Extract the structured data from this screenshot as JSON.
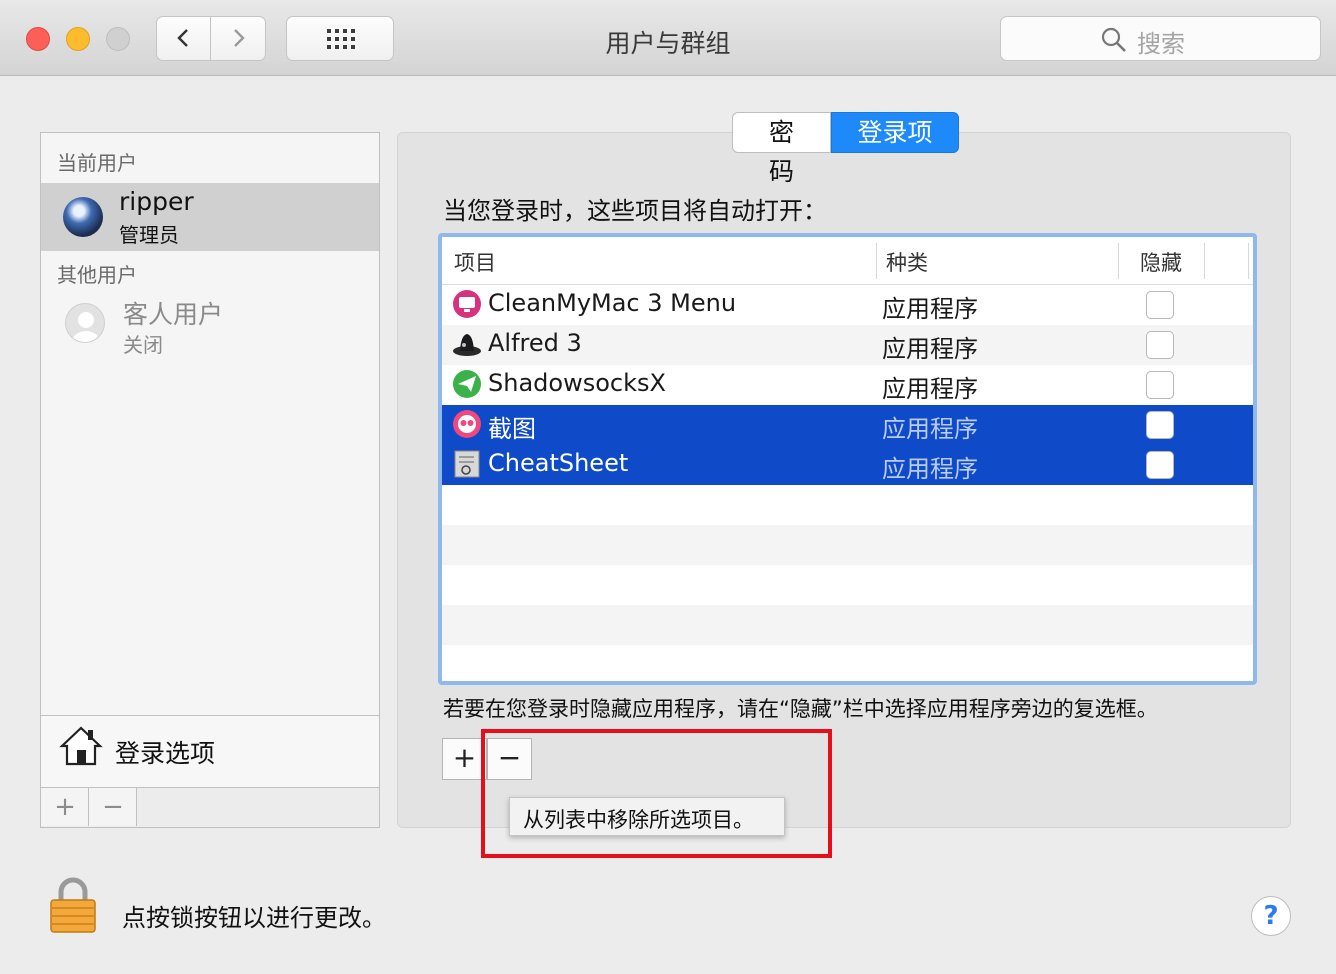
{
  "window": {
    "title": "用户与群组"
  },
  "toolbar": {
    "search_placeholder": "搜索"
  },
  "users": {
    "current_label": "当前用户",
    "current": {
      "name": "ripper",
      "role": "管理员"
    },
    "other_label": "其他用户",
    "guest": {
      "name": "客人用户",
      "state": "关闭"
    },
    "login_options": "登录选项",
    "add_glyph": "+",
    "remove_glyph": "−"
  },
  "tabs": [
    {
      "label": "密码"
    },
    {
      "label": "登录项"
    }
  ],
  "login_items": {
    "intro": "当您登录时，这些项目将自动打开：",
    "columns": {
      "item": "项目",
      "kind": "种类",
      "hide": "隐藏"
    },
    "rows": [
      {
        "name": "CleanMyMac 3 Menu",
        "kind": "应用程序",
        "icon": "cleanmymac-icon",
        "selected": false
      },
      {
        "name": "Alfred 3",
        "kind": "应用程序",
        "icon": "alfred-icon",
        "selected": false
      },
      {
        "name": "ShadowsocksX",
        "kind": "应用程序",
        "icon": "shadowsocks-icon",
        "selected": false
      },
      {
        "name": "截图",
        "kind": "应用程序",
        "icon": "screenshot-app-icon",
        "selected": true
      },
      {
        "name": "CheatSheet",
        "kind": "应用程序",
        "icon": "cheatsheet-icon",
        "selected": true
      }
    ],
    "hint": "若要在您登录时隐藏应用程序，请在“隐藏”栏中选择应用程序旁边的复选框。",
    "add_glyph": "+",
    "remove_glyph": "−",
    "tooltip": "从列表中移除所选项目。"
  },
  "footer": {
    "lock_text": "点按锁按钮以进行更改。",
    "help": "?"
  },
  "colors": {
    "selection": "#0f4ac8",
    "tab_active": "#1e8af9",
    "highlight_box": "#e40f1a"
  }
}
